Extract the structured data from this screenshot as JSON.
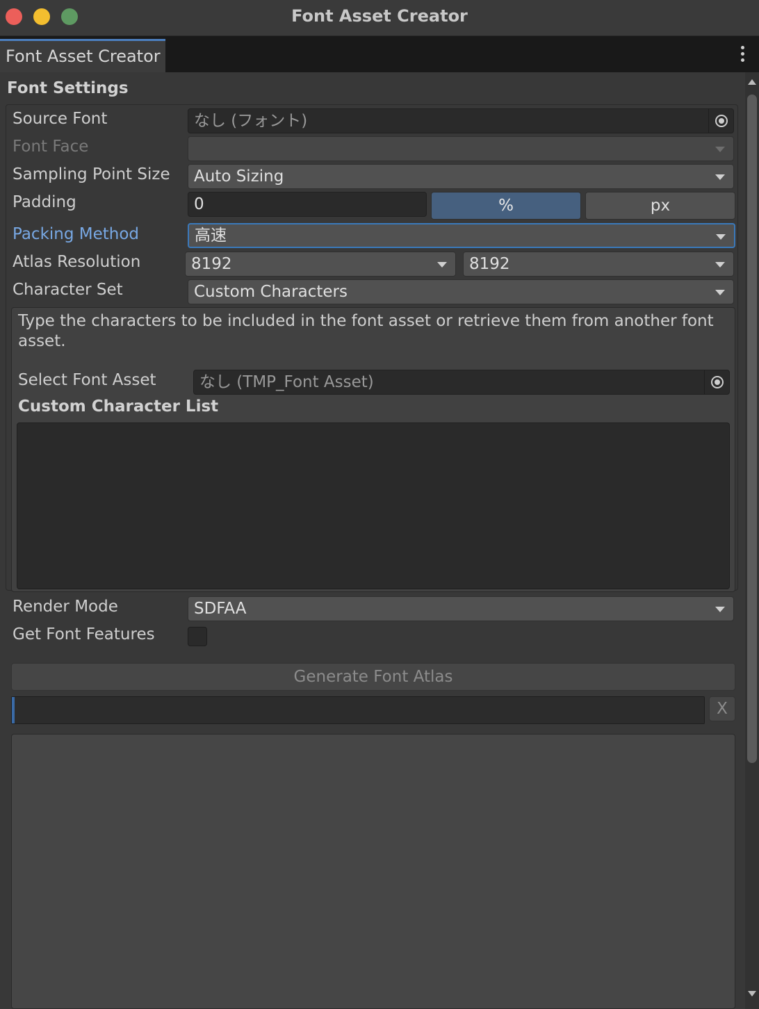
{
  "window": {
    "title": "Font Asset Creator"
  },
  "tab": {
    "label": "Font Asset Creator"
  },
  "font_settings": {
    "header": "Font Settings",
    "source_font": {
      "label": "Source Font",
      "value": "なし (フォント)"
    },
    "font_face": {
      "label": "Font Face",
      "value": ""
    },
    "sampling_point_size": {
      "label": "Sampling Point Size",
      "value": "Auto Sizing"
    },
    "padding": {
      "label": "Padding",
      "value": "0",
      "percent_label": "%",
      "px_label": "px",
      "selected_unit": "%"
    },
    "packing_method": {
      "label": "Packing Method",
      "value": "高速"
    },
    "atlas_resolution": {
      "label": "Atlas Resolution",
      "width": "8192",
      "height": "8192"
    },
    "character_set": {
      "label": "Character Set",
      "value": "Custom Characters"
    },
    "help_text": "Type the characters to be included in the font asset or retrieve them from another font asset.",
    "select_font_asset": {
      "label": "Select Font Asset",
      "value": "なし (TMP_Font Asset)"
    },
    "custom_character_list": {
      "label": "Custom Character List",
      "value": ""
    },
    "render_mode": {
      "label": "Render Mode",
      "value": "SDFAA"
    },
    "get_font_features": {
      "label": "Get Font Features",
      "checked": false
    }
  },
  "actions": {
    "generate_label": "Generate Font Atlas",
    "cancel_label": "X",
    "progress": 0.003
  },
  "colors": {
    "accent": "#3a79bb",
    "selected_toggle": "#46607f",
    "active_label": "#78a8e4",
    "background": "#383838"
  },
  "icons": [
    "close-window-icon",
    "minimize-window-icon",
    "zoom-window-icon",
    "kebab-menu-icon",
    "object-picker-icon",
    "dropdown-caret-icon",
    "scroll-up-icon",
    "scroll-down-icon"
  ]
}
